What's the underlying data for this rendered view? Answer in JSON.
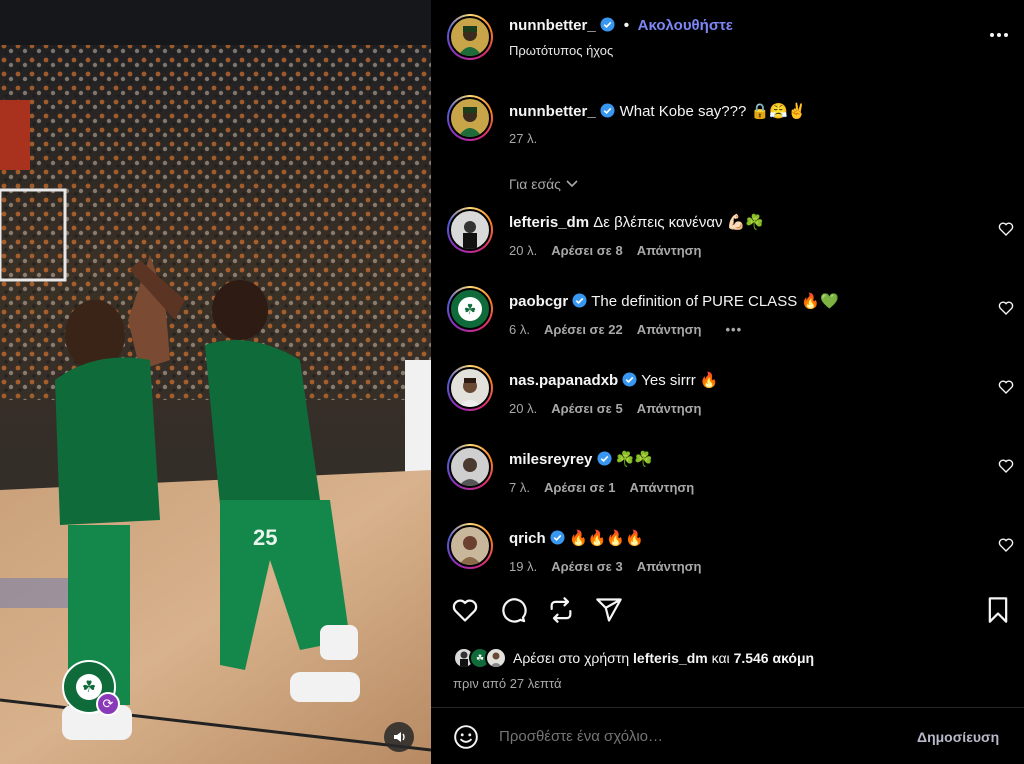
{
  "post": {
    "author": "nunnbetter_",
    "follow_label": "Ακολουθήστε",
    "separator": "•",
    "audio": "Πρωτότυπος ήχος",
    "caption": "What Kobe say??? 🔒😤✌️",
    "caption_time": "27 λ.",
    "for_you_label": "Για εσάς"
  },
  "comments": [
    {
      "user": "lefteris_dm",
      "verified": false,
      "text": "Δε βλέπεις κανέναν 💪🏻☘️",
      "time": "20 λ.",
      "likes": "Αρέσει σε 8",
      "reply": "Απάντηση",
      "more": ""
    },
    {
      "user": "paobcgr",
      "verified": true,
      "text": "The definition of PURE CLASS 🔥💚",
      "time": "6 λ.",
      "likes": "Αρέσει σε 22",
      "reply": "Απάντηση",
      "more": "•••"
    },
    {
      "user": "nas.papanadxb",
      "verified": true,
      "text": "Yes sirrr 🔥",
      "time": "20 λ.",
      "likes": "Αρέσει σε 5",
      "reply": "Απάντηση",
      "more": ""
    },
    {
      "user": "milesreyrey",
      "verified": true,
      "text": "☘️☘️",
      "time": "7 λ.",
      "likes": "Αρέσει σε 1",
      "reply": "Απάντηση",
      "more": ""
    },
    {
      "user": "qrich",
      "verified": true,
      "text": "🔥🔥🔥🔥",
      "time": "19 λ.",
      "likes": "Αρέσει σε 3",
      "reply": "Απάντηση",
      "more": ""
    }
  ],
  "likes": {
    "prefix": "Αρέσει στο χρήστη",
    "user": "lefteris_dm",
    "middle": "και",
    "count": "7.546 ακόμη"
  },
  "posted_ago": "πριν από 27 λεπτά",
  "composer": {
    "placeholder": "Προσθέστε ένα σχόλιο…",
    "post_label": "Δημοσίευση"
  },
  "media": {
    "jersey_number": "25"
  },
  "colors": {
    "follow": "#7d86f5",
    "verified": "#3897f0",
    "jersey": "#0f6b3a",
    "background": "#000000",
    "secondary_text": "#a8a8a8"
  },
  "icons": [
    "heart-icon",
    "comment-icon",
    "repost-icon",
    "share-icon",
    "bookmark-icon",
    "emoji-icon",
    "more-options-icon",
    "audio-icon",
    "remix-icon",
    "chevron-down-icon",
    "verified-badge-icon"
  ]
}
